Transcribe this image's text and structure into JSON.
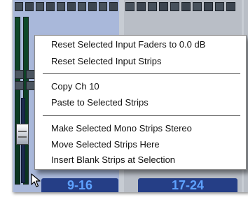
{
  "strips": {
    "bank_a_label": "9-16",
    "bank_b_label": "17-24"
  },
  "context_menu": {
    "items": [
      {
        "label": "Reset Selected Input Faders to 0.0 dB"
      },
      {
        "label": "Reset Selected Input Strips"
      },
      {
        "label": "Copy Ch 10"
      },
      {
        "label": "Paste to Selected Strips"
      },
      {
        "label": "Make Selected Mono Strips Stereo"
      },
      {
        "label": "Move Selected Strips Here"
      },
      {
        "label": "Insert Blank Strips at Selection"
      }
    ]
  },
  "colors": {
    "selected_bank": "#a9b8da",
    "strip_label_bg": "#253e86",
    "strip_label_text": "#5ea2ff"
  },
  "icons": {
    "cursor": "arrow-pointer-icon",
    "fader": "fader-cap-icon"
  }
}
